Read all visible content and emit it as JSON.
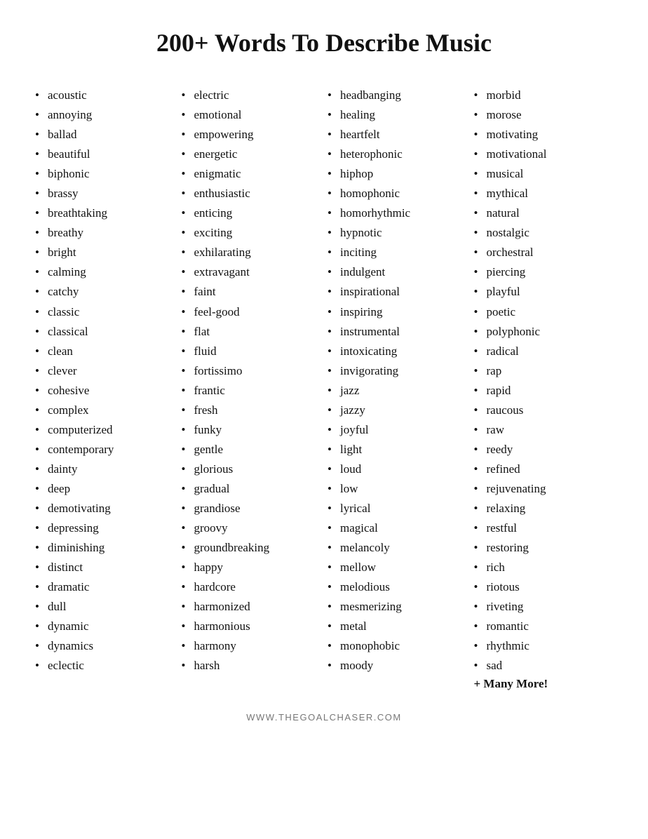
{
  "title": "200+ Words To Describe Music",
  "footer": "WWW.THEGOALCHASER.COM",
  "columns": [
    {
      "id": "col1",
      "words": [
        "acoustic",
        "annoying",
        "ballad",
        "beautiful",
        "biphonic",
        "brassy",
        "breathtaking",
        "breathy",
        "bright",
        "calming",
        "catchy",
        "classic",
        "classical",
        "clean",
        "clever",
        "cohesive",
        "complex",
        "computerized",
        "contemporary",
        "dainty",
        "deep",
        "demotivating",
        "depressing",
        "diminishing",
        "distinct",
        "dramatic",
        "dull",
        "dynamic",
        "dynamics",
        "eclectic"
      ]
    },
    {
      "id": "col2",
      "words": [
        "electric",
        "emotional",
        "empowering",
        "energetic",
        "enigmatic",
        "enthusiastic",
        "enticing",
        "exciting",
        "exhilarating",
        "extravagant",
        "faint",
        "feel-good",
        "flat",
        "fluid",
        "fortissimo",
        "frantic",
        "fresh",
        "funky",
        "gentle",
        "glorious",
        "gradual",
        "grandiose",
        "groovy",
        "groundbreaking",
        "happy",
        "hardcore",
        "harmonized",
        "harmonious",
        "harmony",
        "harsh"
      ]
    },
    {
      "id": "col3",
      "words": [
        "headbanging",
        "healing",
        "heartfelt",
        "heterophonic",
        "hiphop",
        "homophonic",
        "homorhythmic",
        "hypnotic",
        "inciting",
        "indulgent",
        "inspirational",
        "inspiring",
        "instrumental",
        "intoxicating",
        "invigorating",
        "jazz",
        "jazzy",
        "joyful",
        "light",
        "loud",
        "low",
        "lyrical",
        "magical",
        "melancoly",
        "mellow",
        "melodious",
        "mesmerizing",
        "metal",
        "monophobic",
        "moody"
      ]
    },
    {
      "id": "col4",
      "words": [
        "morbid",
        "morose",
        "motivating",
        "motivational",
        "musical",
        "mythical",
        "natural",
        "nostalgic",
        "orchestral",
        "piercing",
        "playful",
        "poetic",
        "polyphonic",
        "radical",
        "rap",
        "rapid",
        "raucous",
        "raw",
        "reedy",
        "refined",
        "rejuvenating",
        "relaxing",
        "restful",
        "restoring",
        "rich",
        "riotous",
        "riveting",
        "romantic",
        "rhythmic",
        "sad"
      ],
      "extra": "+ Many More!"
    }
  ]
}
